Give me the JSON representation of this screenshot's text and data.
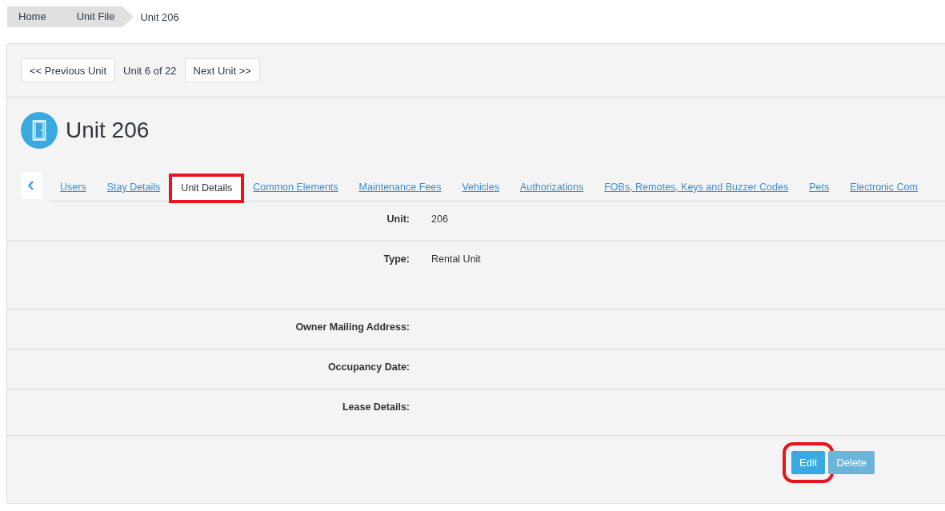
{
  "breadcrumbs": [
    "Home",
    "Unit File",
    "Unit 206"
  ],
  "pager": {
    "previous": "<< Previous Unit",
    "position": "Unit 6 of 22",
    "next": "Next Unit >>"
  },
  "title": "Unit 206",
  "tabs": [
    {
      "label": "Users",
      "selected": false,
      "highlighted": false
    },
    {
      "label": "Stay Details",
      "selected": false,
      "highlighted": false
    },
    {
      "label": "Unit Details",
      "selected": true,
      "highlighted": true
    },
    {
      "label": "Common Elements",
      "selected": false,
      "highlighted": false
    },
    {
      "label": "Maintenance Fees",
      "selected": false,
      "highlighted": false
    },
    {
      "label": "Vehicles",
      "selected": false,
      "highlighted": false
    },
    {
      "label": "Authorizations",
      "selected": false,
      "highlighted": false
    },
    {
      "label": "FOBs, Remotes, Keys and Buzzer Codes",
      "selected": false,
      "highlighted": false
    },
    {
      "label": "Pets",
      "selected": false,
      "highlighted": false
    },
    {
      "label": "Electronic Com",
      "selected": false,
      "highlighted": false
    }
  ],
  "fields": [
    {
      "label": "Unit:",
      "value": "206",
      "kind": "short"
    },
    {
      "label": "Type:",
      "value": "Rental Unit",
      "kind": "tall"
    },
    {
      "label": "Owner Mailing Address:",
      "kind": "short"
    },
    {
      "label": "Occupancy Date:",
      "kind": "short"
    },
    {
      "label": "Lease Details:",
      "kind": "medium"
    }
  ],
  "buttons": [
    {
      "label": "Edit",
      "kind": "primary",
      "highlighted": true
    },
    {
      "label": "Delete",
      "kind": "danger",
      "highlighted": false
    }
  ]
}
